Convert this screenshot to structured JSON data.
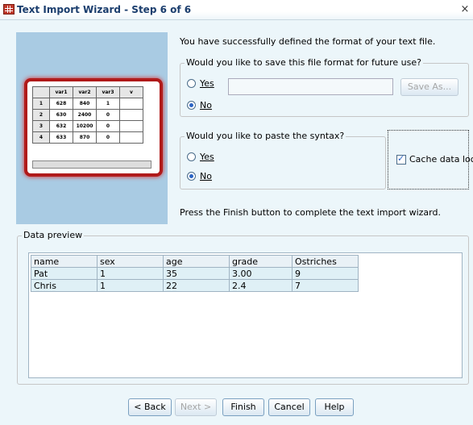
{
  "window": {
    "title": "Text Import Wizard - Step 6 of 6",
    "close_glyph": "×"
  },
  "thumbnail": {
    "columns": [
      "",
      "var1",
      "var2",
      "var3",
      "v"
    ],
    "rows": [
      [
        "1",
        "628",
        "840",
        "1",
        ""
      ],
      [
        "2",
        "630",
        "2400",
        "0",
        ""
      ],
      [
        "3",
        "632",
        "10200",
        "0",
        ""
      ],
      [
        "4",
        "633",
        "870",
        "0",
        ""
      ]
    ]
  },
  "success_message": "You have successfully defined the format of your text file.",
  "save_format": {
    "legend": "Would you like to save this file format for future use?",
    "yes_label": "Yes",
    "no_label": "No",
    "selected": "no",
    "filename_value": "",
    "save_as_label": "Save As..."
  },
  "paste_syntax": {
    "legend": "Would you like to paste the syntax?",
    "yes_label": "Yes",
    "no_label": "No",
    "selected": "no"
  },
  "cache": {
    "label": "Cache data locally",
    "checked": true
  },
  "finish_message": "Press the Finish button to complete the text import wizard.",
  "data_preview": {
    "legend": "Data preview",
    "columns": [
      "name",
      "sex",
      "age",
      "grade",
      "Ostriches"
    ],
    "rows": [
      [
        "Pat",
        "1",
        "35",
        "3.00",
        "9"
      ],
      [
        "Chris",
        "1",
        "22",
        "2.4",
        "7"
      ]
    ]
  },
  "buttons": {
    "back": "< Back",
    "next": "Next >",
    "finish": "Finish",
    "cancel": "Cancel",
    "help": "Help"
  }
}
